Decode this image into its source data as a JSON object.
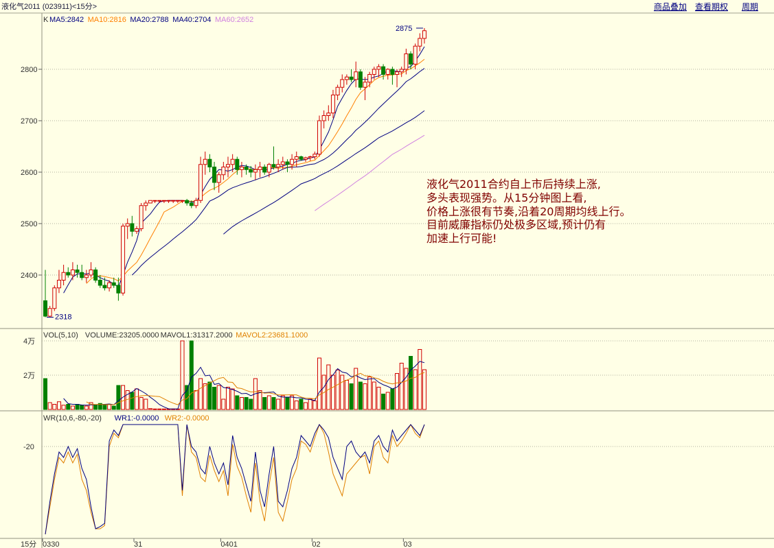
{
  "header": {
    "title": "液化气2011 (023911)<15分>",
    "links": [
      "商品叠加",
      "查看期权",
      "周期"
    ]
  },
  "price_panel": {
    "k_label": "K",
    "ma": [
      {
        "label": "MA5:2842",
        "color": "#000080"
      },
      {
        "label": "MA10:2816",
        "color": "#ff8000"
      },
      {
        "label": "MA20:2788",
        "color": "#000080"
      },
      {
        "label": "MA40:2704",
        "color": "#000080"
      },
      {
        "label": "MA60:2652",
        "color": "#d080e0"
      }
    ],
    "y_ticks": [
      "2800",
      "2700",
      "2600",
      "2500",
      "2400"
    ],
    "high_label": "2875",
    "low_label": "2318",
    "annotation": [
      "液化气2011合约自上市后持续上涨,",
      "多头表现强势。从15分钟图上看,",
      "价格上涨很有节奏,沿着20周期均线上行。",
      "目前威廉指标仍处极多区域,预计仍有",
      "加速上行可能!"
    ]
  },
  "volume_panel": {
    "labels": [
      {
        "text": "VOL(5,10)",
        "color": "#303030"
      },
      {
        "text": "VOLUME:23205.0000",
        "color": "#303030"
      },
      {
        "text": "MAVOL1:31317.2000",
        "color": "#303030"
      },
      {
        "text": "MAVOL2:23681.1000",
        "color": "#e08000"
      }
    ],
    "y_ticks": [
      "4万",
      "2万"
    ]
  },
  "wr_panel": {
    "labels": [
      {
        "text": "WR(10,6,-80,-20)",
        "color": "#303030"
      },
      {
        "text": "WR1:-0.0000",
        "color": "#000080"
      },
      {
        "text": "WR2:-0.0000",
        "color": "#e08000"
      }
    ],
    "y_ticks": [
      "-20"
    ]
  },
  "x_axis": {
    "period": "15分",
    "ticks": [
      "0330",
      "31",
      "0401",
      "02",
      "03"
    ]
  },
  "colors": {
    "background": "#ffffe6",
    "up": "#d00000",
    "down": "#008000",
    "grid": "#b0b0a0",
    "ma5": "#000080",
    "ma10": "#ff8000",
    "ma20": "#000080",
    "ma40": "#000080",
    "ma60": "#d080e0",
    "wr1": "#000080",
    "wr2": "#e08000",
    "annotation": "#800000"
  },
  "chart_data": {
    "type": "candlestick",
    "x_ticks": [
      {
        "index": 0,
        "label": "0330"
      },
      {
        "index": 20,
        "label": "31"
      },
      {
        "index": 39,
        "label": "0401"
      },
      {
        "index": 59,
        "label": "02"
      },
      {
        "index": 79,
        "label": "03"
      }
    ],
    "candles": [
      [
        2350,
        2410,
        2318,
        2320
      ],
      [
        2320,
        2340,
        2318,
        2335
      ],
      [
        2335,
        2380,
        2330,
        2375
      ],
      [
        2375,
        2410,
        2365,
        2390
      ],
      [
        2390,
        2420,
        2380,
        2405
      ],
      [
        2405,
        2415,
        2395,
        2400
      ],
      [
        2400,
        2425,
        2390,
        2410
      ],
      [
        2410,
        2420,
        2395,
        2405
      ],
      [
        2405,
        2420,
        2390,
        2395
      ],
      [
        2395,
        2410,
        2385,
        2400
      ],
      [
        2400,
        2425,
        2395,
        2410
      ],
      [
        2410,
        2415,
        2385,
        2390
      ],
      [
        2390,
        2400,
        2375,
        2380
      ],
      [
        2380,
        2395,
        2370,
        2375
      ],
      [
        2375,
        2390,
        2368,
        2385
      ],
      [
        2385,
        2395,
        2375,
        2380
      ],
      [
        2380,
        2395,
        2350,
        2365
      ],
      [
        2365,
        2500,
        2360,
        2495
      ],
      [
        2495,
        2510,
        2470,
        2500
      ],
      [
        2500,
        2515,
        2475,
        2485
      ],
      [
        2485,
        2495,
        2480,
        2490
      ],
      [
        2490,
        2540,
        2485,
        2535
      ],
      [
        2535,
        2545,
        2525,
        2540
      ],
      [
        2540,
        2545,
        2540,
        2545
      ],
      [
        2545,
        2545,
        2540,
        2545
      ],
      [
        2545,
        2545,
        2540,
        2545
      ],
      [
        2545,
        2545,
        2540,
        2545
      ],
      [
        2545,
        2545,
        2540,
        2545
      ],
      [
        2545,
        2545,
        2540,
        2545
      ],
      [
        2545,
        2545,
        2540,
        2545
      ],
      [
        2545,
        2545,
        2540,
        2545
      ],
      [
        2545,
        2548,
        2535,
        2540
      ],
      [
        2540,
        2545,
        2530,
        2535
      ],
      [
        2535,
        2550,
        2530,
        2545
      ],
      [
        2545,
        2630,
        2540,
        2615
      ],
      [
        2615,
        2640,
        2595,
        2625
      ],
      [
        2625,
        2635,
        2600,
        2610
      ],
      [
        2610,
        2620,
        2565,
        2580
      ],
      [
        2580,
        2600,
        2560,
        2595
      ],
      [
        2595,
        2620,
        2585,
        2610
      ],
      [
        2610,
        2630,
        2590,
        2615
      ],
      [
        2615,
        2635,
        2600,
        2625
      ],
      [
        2625,
        2630,
        2595,
        2605
      ],
      [
        2605,
        2620,
        2590,
        2610
      ],
      [
        2610,
        2615,
        2595,
        2605
      ],
      [
        2605,
        2612,
        2590,
        2600
      ],
      [
        2600,
        2615,
        2585,
        2605
      ],
      [
        2605,
        2620,
        2590,
        2610
      ],
      [
        2610,
        2615,
        2595,
        2600
      ],
      [
        2600,
        2618,
        2590,
        2615
      ],
      [
        2615,
        2650,
        2605,
        2610
      ],
      [
        2610,
        2625,
        2600,
        2615
      ],
      [
        2615,
        2630,
        2605,
        2620
      ],
      [
        2620,
        2625,
        2600,
        2615
      ],
      [
        2615,
        2635,
        2605,
        2625
      ],
      [
        2625,
        2640,
        2610,
        2630
      ],
      [
        2630,
        2632,
        2622,
        2625
      ],
      [
        2625,
        2630,
        2620,
        2628
      ],
      [
        2628,
        2632,
        2622,
        2630
      ],
      [
        2630,
        2640,
        2625,
        2635
      ],
      [
        2635,
        2710,
        2630,
        2700
      ],
      [
        2700,
        2720,
        2685,
        2710
      ],
      [
        2710,
        2730,
        2700,
        2715
      ],
      [
        2715,
        2760,
        2705,
        2750
      ],
      [
        2750,
        2770,
        2740,
        2765
      ],
      [
        2765,
        2790,
        2755,
        2780
      ],
      [
        2780,
        2790,
        2770,
        2785
      ],
      [
        2785,
        2800,
        2775,
        2780
      ],
      [
        2780,
        2815,
        2765,
        2795
      ],
      [
        2795,
        2800,
        2760,
        2765
      ],
      [
        2765,
        2785,
        2740,
        2775
      ],
      [
        2775,
        2795,
        2765,
        2790
      ],
      [
        2790,
        2805,
        2780,
        2800
      ],
      [
        2800,
        2810,
        2785,
        2805
      ],
      [
        2805,
        2810,
        2780,
        2790
      ],
      [
        2790,
        2802,
        2780,
        2800
      ],
      [
        2800,
        2805,
        2770,
        2790
      ],
      [
        2790,
        2800,
        2765,
        2795
      ],
      [
        2795,
        2805,
        2785,
        2800
      ],
      [
        2800,
        2840,
        2790,
        2830
      ],
      [
        2830,
        2835,
        2800,
        2810
      ],
      [
        2810,
        2850,
        2800,
        2845
      ],
      [
        2845,
        2870,
        2835,
        2860
      ],
      [
        2860,
        2880,
        2850,
        2875
      ]
    ],
    "volume": [
      18000,
      4000,
      3000,
      4500,
      2500,
      3000,
      2000,
      3000,
      2500,
      2000,
      4000,
      2500,
      3500,
      3000,
      3000,
      2000,
      14000,
      14000,
      11000,
      10000,
      12000,
      7000,
      6000,
      500,
      300,
      300,
      300,
      300,
      300,
      300,
      40000,
      14000,
      40000,
      11000,
      18000,
      15000,
      16000,
      13000,
      14000,
      6000,
      13000,
      12000,
      8000,
      7000,
      7000,
      6000,
      18000,
      11000,
      7000,
      8000,
      7000,
      6000,
      8000,
      7000,
      8000,
      5000,
      6000,
      4000,
      6000,
      5000,
      30000,
      20000,
      26000,
      20000,
      23000,
      20000,
      17000,
      15000,
      24000,
      16000,
      15000,
      19000,
      16000,
      13000,
      9000,
      10000,
      12000,
      21000,
      27000,
      24000,
      31000,
      23205,
      35000,
      23205
    ],
    "wr1": [
      -100,
      -70,
      -45,
      -25,
      -30,
      -20,
      -30,
      -22,
      -40,
      -50,
      -75,
      -95,
      -93,
      -90,
      -15,
      -5,
      -10,
      0,
      0,
      0,
      0,
      0,
      0,
      0,
      0,
      0,
      0,
      0,
      0,
      0,
      -60,
      0,
      -20,
      -25,
      -40,
      -45,
      -20,
      -35,
      -45,
      -35,
      -55,
      -10,
      -30,
      -40,
      -55,
      -70,
      -25,
      -60,
      -75,
      -45,
      -20,
      -70,
      -75,
      -60,
      -40,
      -30,
      -10,
      -15,
      -20,
      -8,
      0,
      -5,
      -12,
      -30,
      -40,
      -50,
      -20,
      -15,
      -25,
      -30,
      -25,
      -35,
      -15,
      -10,
      -20,
      -25,
      -5,
      -15,
      -10,
      -5,
      0,
      -5,
      -10,
      0
    ],
    "wr2": [
      -100,
      -75,
      -50,
      -30,
      -35,
      -25,
      -35,
      -27,
      -50,
      -60,
      -80,
      -95,
      -95,
      -92,
      -20,
      -8,
      -12,
      0,
      0,
      0,
      0,
      0,
      0,
      0,
      0,
      0,
      0,
      0,
      0,
      0,
      -65,
      0,
      -25,
      -30,
      -48,
      -52,
      -28,
      -42,
      -52,
      -42,
      -65,
      -18,
      -38,
      -48,
      -65,
      -80,
      -35,
      -70,
      -88,
      -55,
      -30,
      -80,
      -88,
      -70,
      -50,
      -40,
      -15,
      -18,
      -25,
      -12,
      0,
      -8,
      -25,
      -45,
      -55,
      -65,
      -45,
      -40,
      -35,
      -30,
      -28,
      -45,
      -20,
      -15,
      -30,
      -35,
      -10,
      -20,
      -15,
      -8,
      0,
      -8,
      -12,
      0
    ]
  }
}
